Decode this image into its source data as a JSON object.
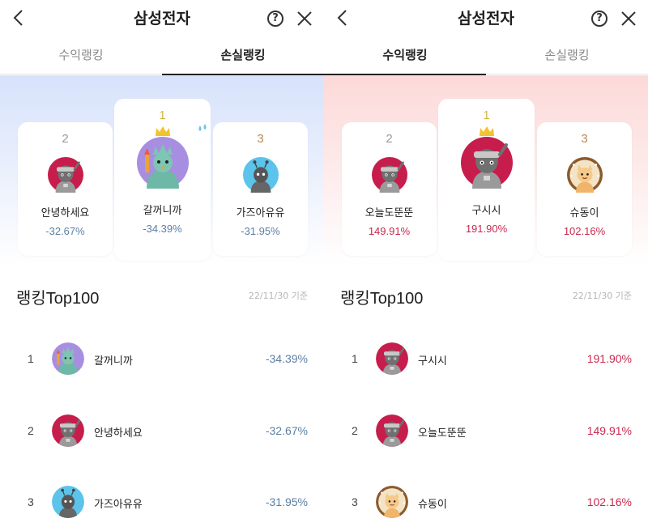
{
  "colors": {
    "loss": "#5b7fa4",
    "profit": "#c8294e",
    "gold": "#d5b64a"
  },
  "panels": [
    {
      "header": {
        "title": "삼성전자",
        "help_glyph": "?"
      },
      "tabs": [
        {
          "label": "수익랭킹",
          "active": false
        },
        {
          "label": "손실랭킹",
          "active": true
        }
      ],
      "podium": [
        {
          "rank": "1",
          "name": "갈꺼니까",
          "rate": "-34.39%",
          "avatar": "statue-avatar"
        },
        {
          "rank": "2",
          "name": "안녕하세요",
          "rate": "-32.67%",
          "avatar": "robot-avatar"
        },
        {
          "rank": "3",
          "name": "가즈아유유",
          "rate": "-31.95%",
          "avatar": "alien-avatar"
        }
      ],
      "section": {
        "title": "랭킹Top100",
        "date": "22/11/30 기준"
      },
      "list": [
        {
          "rank": "1",
          "name": "갈꺼니까",
          "rate": "-34.39%"
        },
        {
          "rank": "2",
          "name": "안녕하세요",
          "rate": "-32.67%"
        },
        {
          "rank": "3",
          "name": "가즈아유유",
          "rate": "-31.95%"
        }
      ]
    },
    {
      "header": {
        "title": "삼성전자",
        "help_glyph": "?"
      },
      "tabs": [
        {
          "label": "수익랭킹",
          "active": true
        },
        {
          "label": "손실랭킹",
          "active": false
        }
      ],
      "podium": [
        {
          "rank": "1",
          "name": "구시시",
          "rate": "191.90%",
          "avatar": "robot-avatar"
        },
        {
          "rank": "2",
          "name": "오늘도뚠뚠",
          "rate": "149.91%",
          "avatar": "robot-avatar"
        },
        {
          "rank": "3",
          "name": "슈동이",
          "rate": "102.16%",
          "avatar": "cat-avatar"
        }
      ],
      "section": {
        "title": "랭킹Top100",
        "date": "22/11/30 기준"
      },
      "list": [
        {
          "rank": "1",
          "name": "구시시",
          "rate": "191.90%"
        },
        {
          "rank": "2",
          "name": "오늘도뚠뚠",
          "rate": "149.91%"
        },
        {
          "rank": "3",
          "name": "슈동이",
          "rate": "102.16%"
        }
      ]
    }
  ]
}
